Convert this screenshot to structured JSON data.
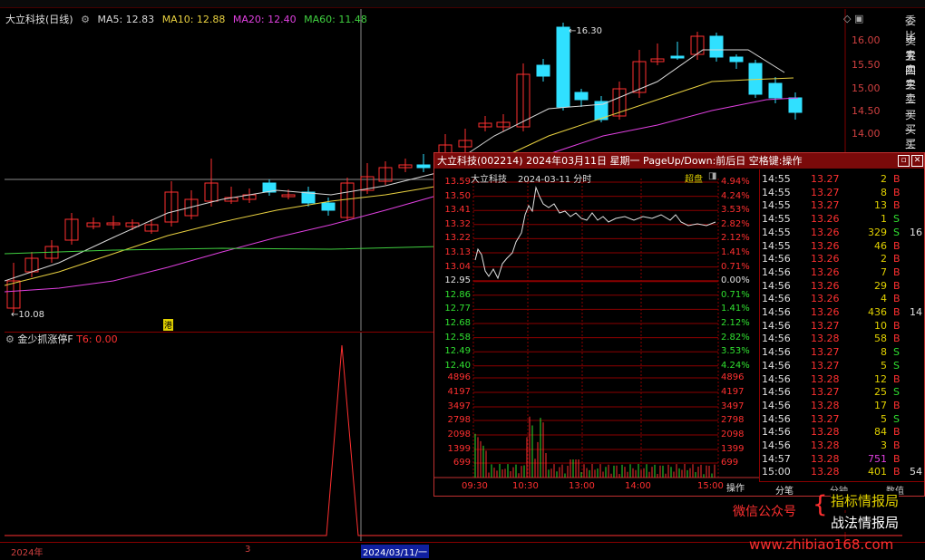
{
  "stock": {
    "name_period": "大立科技(日线)",
    "ma": [
      {
        "label": "MA5: 12.83",
        "color": "#d8d8d8"
      },
      {
        "label": "MA10: 12.88",
        "color": "#e8d040"
      },
      {
        "label": "MA20: 12.40",
        "color": "#e040e0"
      },
      {
        "label": "MA60: 11.48",
        "color": "#40d040"
      }
    ],
    "high_label": "16.30",
    "low_label": "10.08",
    "tag": "港"
  },
  "price_axis": [
    "16.00",
    "15.50",
    "15.00",
    "14.50",
    "14.00"
  ],
  "indicator": {
    "name": "金少抓涨停F",
    "value": "T6: 0.00"
  },
  "bottom": {
    "year": "2024年",
    "mark": "3",
    "date": "2024/03/11/一"
  },
  "quote_side": [
    "委比",
    "卖五",
    "卖四",
    "卖三",
    "卖二",
    "卖一",
    "买一",
    "买二",
    "买三",
    "买四"
  ],
  "popup": {
    "title": "大立科技(002214)  2024年03月11日 星期一 PageUp/Down:前后日 空格键:操作",
    "chart_name": "大立科技",
    "chart_date": "2024-03-11 分时",
    "chart_mode": "超盘",
    "left_axis": [
      "13.59",
      "13.50",
      "13.41",
      "13.32",
      "13.22",
      "13.13",
      "13.04",
      "12.95",
      "12.86",
      "12.77",
      "12.68",
      "12.58",
      "12.49",
      "12.40"
    ],
    "right_axis": [
      "4.94%",
      "4.24%",
      "3.53%",
      "2.82%",
      "2.12%",
      "1.41%",
      "0.71%",
      "0.00%",
      "0.71%",
      "1.41%",
      "2.12%",
      "2.82%",
      "3.53%",
      "4.24%"
    ],
    "vol_axis": [
      "4896",
      "4197",
      "3497",
      "2798",
      "2098",
      "1399",
      "699"
    ],
    "time_axis": [
      "09:30",
      "10:30",
      "13:00",
      "14:00",
      "15:00"
    ],
    "ops": "操作",
    "ticks": [
      {
        "t": "14:55",
        "p": "13.27",
        "v": "2",
        "s": "B"
      },
      {
        "t": "14:55",
        "p": "13.27",
        "v": "8",
        "s": "B"
      },
      {
        "t": "14:55",
        "p": "13.27",
        "v": "13",
        "s": "B"
      },
      {
        "t": "14:55",
        "p": "13.26",
        "v": "1",
        "s": "S"
      },
      {
        "t": "14:55",
        "p": "13.26",
        "v": "329",
        "s": "S",
        "x": "16"
      },
      {
        "t": "14:55",
        "p": "13.26",
        "v": "46",
        "s": "B"
      },
      {
        "t": "14:56",
        "p": "13.26",
        "v": "2",
        "s": "B"
      },
      {
        "t": "14:56",
        "p": "13.26",
        "v": "7",
        "s": "B"
      },
      {
        "t": "14:56",
        "p": "13.26",
        "v": "29",
        "s": "B"
      },
      {
        "t": "14:56",
        "p": "13.26",
        "v": "4",
        "s": "B"
      },
      {
        "t": "14:56",
        "p": "13.26",
        "v": "436",
        "s": "B",
        "x": "14"
      },
      {
        "t": "14:56",
        "p": "13.27",
        "v": "10",
        "s": "B"
      },
      {
        "t": "14:56",
        "p": "13.28",
        "v": "58",
        "s": "B"
      },
      {
        "t": "14:56",
        "p": "13.27",
        "v": "8",
        "s": "S"
      },
      {
        "t": "14:56",
        "p": "13.27",
        "v": "5",
        "s": "S"
      },
      {
        "t": "14:56",
        "p": "13.28",
        "v": "12",
        "s": "B"
      },
      {
        "t": "14:56",
        "p": "13.27",
        "v": "25",
        "s": "S"
      },
      {
        "t": "14:56",
        "p": "13.28",
        "v": "17",
        "s": "B"
      },
      {
        "t": "14:56",
        "p": "13.27",
        "v": "5",
        "s": "S"
      },
      {
        "t": "14:56",
        "p": "13.28",
        "v": "84",
        "s": "B"
      },
      {
        "t": "14:56",
        "p": "13.28",
        "v": "3",
        "s": "B"
      },
      {
        "t": "14:57",
        "p": "13.28",
        "v": "751",
        "s": "B",
        "big": true
      },
      {
        "t": "15:00",
        "p": "13.28",
        "v": "401",
        "s": "B",
        "x": "54"
      }
    ],
    "tabs": [
      "分笔",
      "分钟",
      "数值"
    ]
  },
  "watermark": {
    "wechat": "微信公众号",
    "line1": "指标情报局",
    "line2": "战法情报局",
    "site": "www.zhibiao168.com"
  },
  "colors": {
    "up": "#ff3030",
    "down": "#30e0ff",
    "grid": "#8b0000"
  }
}
